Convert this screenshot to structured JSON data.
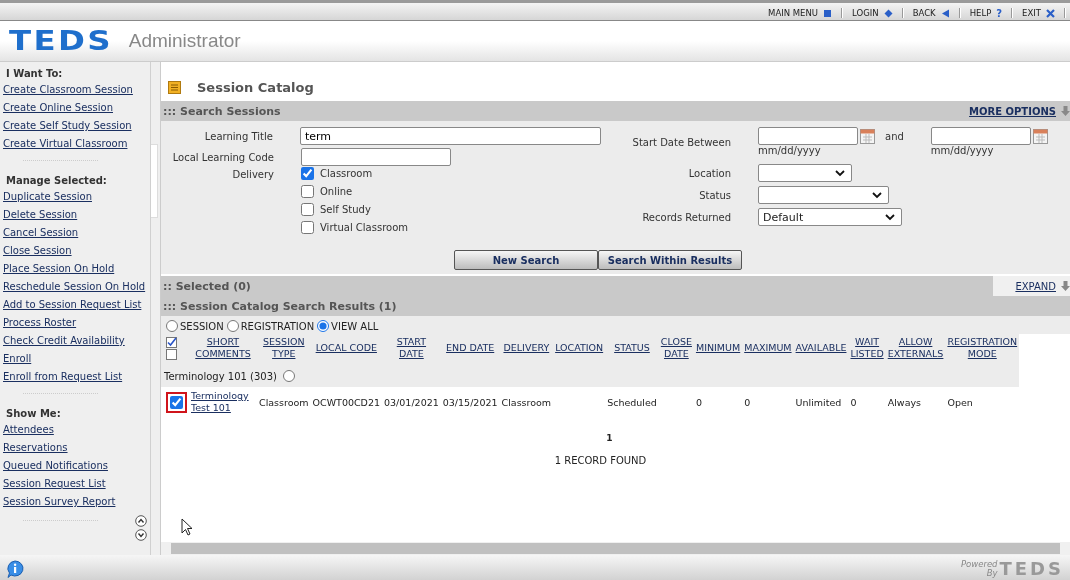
{
  "top_nav": [
    {
      "label": "MAIN MENU"
    },
    {
      "label": "LOGIN"
    },
    {
      "label": "BACK"
    },
    {
      "label": "HELP",
      "glyph": "?"
    },
    {
      "label": "EXIT"
    }
  ],
  "header": {
    "logo": "TEDS",
    "product": "Administrator"
  },
  "sidebar": {
    "sections": [
      {
        "title": "I Want To:",
        "items": [
          "Create Classroom Session",
          "Create Online Session",
          "Create Self Study Session",
          "Create Virtual Classroom"
        ]
      },
      {
        "title": "Manage Selected:",
        "items": [
          "Duplicate Session",
          "Delete Session",
          "Cancel Session",
          "Close Session",
          "Place Session On Hold",
          "Reschedule Session On Hold",
          "Add to Session Request List",
          "Process Roster",
          "Check Credit Availability",
          "Enroll",
          "Enroll from Request List"
        ]
      },
      {
        "title": "Show Me:",
        "items": [
          "Attendees",
          "Reservations",
          "Queued Notifications",
          "Session Request List",
          "Session Survey Report"
        ]
      }
    ]
  },
  "page_title": "Session Catalog",
  "search_panel": {
    "title": "::: Search Sessions",
    "more_options": "MORE OPTIONS",
    "learning_title": {
      "label": "Learning Title",
      "value": "term"
    },
    "local_code": {
      "label": "Local Learning Code"
    },
    "delivery": {
      "label": "Delivery",
      "options": [
        {
          "label": "Classroom",
          "checked": true
        },
        {
          "label": "Online",
          "checked": false
        },
        {
          "label": "Self Study",
          "checked": false
        },
        {
          "label": "Virtual Classroom",
          "checked": false
        }
      ]
    },
    "start_date": {
      "label": "Start Date Between",
      "and": "and",
      "hint_from": "mm/dd/yyyy",
      "hint_to": "mm/dd/yyyy"
    },
    "selects": [
      {
        "label": "Location"
      },
      {
        "label": "Status"
      },
      {
        "label": "Records Returned",
        "value": "Default"
      }
    ],
    "buttons": [
      "New Search",
      "Search Within Results"
    ]
  },
  "selected_panel": {
    "title": ":: Selected (0)",
    "expand": "EXPAND"
  },
  "results": {
    "title": "::: Session Catalog Search Results (1)",
    "view_options": [
      {
        "label": "SESSION",
        "selected": false
      },
      {
        "label": "REGISTRATION",
        "selected": false
      },
      {
        "label": "VIEW ALL",
        "selected": true
      }
    ],
    "columns": [
      {
        "lines": [
          "SHORT",
          "COMMENTS"
        ]
      },
      {
        "lines": [
          "SESSION",
          "TYPE"
        ]
      },
      {
        "lines": [
          "LOCAL CODE"
        ]
      },
      {
        "lines": [
          "START",
          "DATE"
        ]
      },
      {
        "lines": [
          "END DATE"
        ]
      },
      {
        "lines": [
          "DELIVERY"
        ]
      },
      {
        "lines": [
          "LOCATION"
        ]
      },
      {
        "lines": [
          "STATUS"
        ]
      },
      {
        "lines": [
          "CLOSE",
          "DATE"
        ]
      },
      {
        "lines": [
          "MINIMUM"
        ]
      },
      {
        "lines": [
          "MAXIMUM"
        ]
      },
      {
        "lines": [
          "AVAILABLE"
        ]
      },
      {
        "lines": [
          "WAIT",
          "LISTED"
        ]
      },
      {
        "lines": [
          "ALLOW",
          "EXTERNALS"
        ]
      },
      {
        "lines": [
          "REGISTRATION",
          "MODE"
        ]
      }
    ],
    "groups": [
      {
        "title": "Terminology 101 (303)",
        "selected": false,
        "rows": [
          {
            "checked": true,
            "cells": [
              "Terminology Test 101",
              "Classroom",
              "OCWT00CD21",
              "03/01/2021",
              "03/15/2021",
              "Classroom",
              "",
              "Scheduled",
              "",
              "0",
              "0",
              "Unlimited",
              "0",
              "Always",
              "Open"
            ]
          }
        ]
      }
    ],
    "page": "1",
    "record_count": "1  RECORD FOUND"
  },
  "footer": {
    "powered": "Powered",
    "by": "By",
    "logo": "TEDS"
  }
}
